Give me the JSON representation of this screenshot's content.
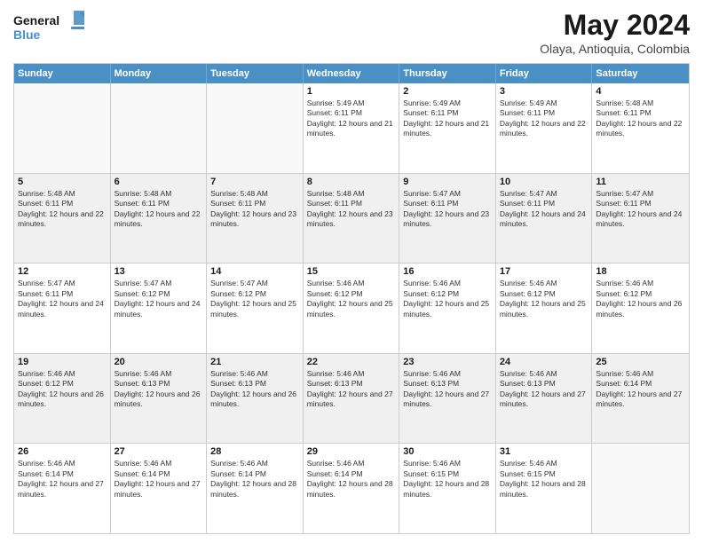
{
  "header": {
    "logo_general": "General",
    "logo_blue": "Blue",
    "month_year": "May 2024",
    "location": "Olaya, Antioquia, Colombia"
  },
  "weekdays": [
    "Sunday",
    "Monday",
    "Tuesday",
    "Wednesday",
    "Thursday",
    "Friday",
    "Saturday"
  ],
  "weeks": [
    [
      {
        "day": "",
        "empty": true
      },
      {
        "day": "",
        "empty": true
      },
      {
        "day": "",
        "empty": true
      },
      {
        "day": "1",
        "sunrise": "5:49 AM",
        "sunset": "6:11 PM",
        "daylight": "12 hours and 21 minutes."
      },
      {
        "day": "2",
        "sunrise": "5:49 AM",
        "sunset": "6:11 PM",
        "daylight": "12 hours and 21 minutes."
      },
      {
        "day": "3",
        "sunrise": "5:49 AM",
        "sunset": "6:11 PM",
        "daylight": "12 hours and 22 minutes."
      },
      {
        "day": "4",
        "sunrise": "5:48 AM",
        "sunset": "6:11 PM",
        "daylight": "12 hours and 22 minutes."
      }
    ],
    [
      {
        "day": "5",
        "sunrise": "5:48 AM",
        "sunset": "6:11 PM",
        "daylight": "12 hours and 22 minutes."
      },
      {
        "day": "6",
        "sunrise": "5:48 AM",
        "sunset": "6:11 PM",
        "daylight": "12 hours and 22 minutes."
      },
      {
        "day": "7",
        "sunrise": "5:48 AM",
        "sunset": "6:11 PM",
        "daylight": "12 hours and 23 minutes."
      },
      {
        "day": "8",
        "sunrise": "5:48 AM",
        "sunset": "6:11 PM",
        "daylight": "12 hours and 23 minutes."
      },
      {
        "day": "9",
        "sunrise": "5:47 AM",
        "sunset": "6:11 PM",
        "daylight": "12 hours and 23 minutes."
      },
      {
        "day": "10",
        "sunrise": "5:47 AM",
        "sunset": "6:11 PM",
        "daylight": "12 hours and 24 minutes."
      },
      {
        "day": "11",
        "sunrise": "5:47 AM",
        "sunset": "6:11 PM",
        "daylight": "12 hours and 24 minutes."
      }
    ],
    [
      {
        "day": "12",
        "sunrise": "5:47 AM",
        "sunset": "6:11 PM",
        "daylight": "12 hours and 24 minutes."
      },
      {
        "day": "13",
        "sunrise": "5:47 AM",
        "sunset": "6:12 PM",
        "daylight": "12 hours and 24 minutes."
      },
      {
        "day": "14",
        "sunrise": "5:47 AM",
        "sunset": "6:12 PM",
        "daylight": "12 hours and 25 minutes."
      },
      {
        "day": "15",
        "sunrise": "5:46 AM",
        "sunset": "6:12 PM",
        "daylight": "12 hours and 25 minutes."
      },
      {
        "day": "16",
        "sunrise": "5:46 AM",
        "sunset": "6:12 PM",
        "daylight": "12 hours and 25 minutes."
      },
      {
        "day": "17",
        "sunrise": "5:46 AM",
        "sunset": "6:12 PM",
        "daylight": "12 hours and 25 minutes."
      },
      {
        "day": "18",
        "sunrise": "5:46 AM",
        "sunset": "6:12 PM",
        "daylight": "12 hours and 26 minutes."
      }
    ],
    [
      {
        "day": "19",
        "sunrise": "5:46 AM",
        "sunset": "6:12 PM",
        "daylight": "12 hours and 26 minutes."
      },
      {
        "day": "20",
        "sunrise": "5:46 AM",
        "sunset": "6:13 PM",
        "daylight": "12 hours and 26 minutes."
      },
      {
        "day": "21",
        "sunrise": "5:46 AM",
        "sunset": "6:13 PM",
        "daylight": "12 hours and 26 minutes."
      },
      {
        "day": "22",
        "sunrise": "5:46 AM",
        "sunset": "6:13 PM",
        "daylight": "12 hours and 27 minutes."
      },
      {
        "day": "23",
        "sunrise": "5:46 AM",
        "sunset": "6:13 PM",
        "daylight": "12 hours and 27 minutes."
      },
      {
        "day": "24",
        "sunrise": "5:46 AM",
        "sunset": "6:13 PM",
        "daylight": "12 hours and 27 minutes."
      },
      {
        "day": "25",
        "sunrise": "5:46 AM",
        "sunset": "6:14 PM",
        "daylight": "12 hours and 27 minutes."
      }
    ],
    [
      {
        "day": "26",
        "sunrise": "5:46 AM",
        "sunset": "6:14 PM",
        "daylight": "12 hours and 27 minutes."
      },
      {
        "day": "27",
        "sunrise": "5:46 AM",
        "sunset": "6:14 PM",
        "daylight": "12 hours and 27 minutes."
      },
      {
        "day": "28",
        "sunrise": "5:46 AM",
        "sunset": "6:14 PM",
        "daylight": "12 hours and 28 minutes."
      },
      {
        "day": "29",
        "sunrise": "5:46 AM",
        "sunset": "6:14 PM",
        "daylight": "12 hours and 28 minutes."
      },
      {
        "day": "30",
        "sunrise": "5:46 AM",
        "sunset": "6:15 PM",
        "daylight": "12 hours and 28 minutes."
      },
      {
        "day": "31",
        "sunrise": "5:46 AM",
        "sunset": "6:15 PM",
        "daylight": "12 hours and 28 minutes."
      },
      {
        "day": "",
        "empty": true
      }
    ]
  ]
}
